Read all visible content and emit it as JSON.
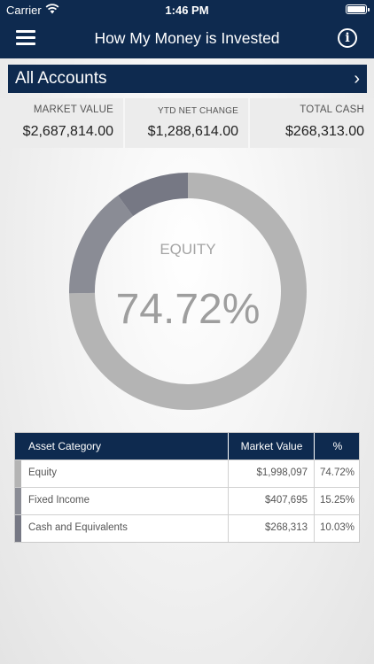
{
  "status_bar": {
    "carrier": "Carrier",
    "time": "1:46 PM"
  },
  "navbar": {
    "title": "How My Money is Invested",
    "info_glyph": "i",
    "menu_icon": "hamburger-menu-icon"
  },
  "accounts": {
    "label": "All Accounts",
    "chevron": "›"
  },
  "summary": [
    {
      "label": "MARKET VALUE",
      "value": "$2,687,814.00"
    },
    {
      "label": "YTD NET CHANGE",
      "value": "$1,288,614.00"
    },
    {
      "label": "TOTAL CASH",
      "value": "$268,313.00"
    }
  ],
  "donut": {
    "label": "EQUITY",
    "value": "74.72%",
    "segments": [
      {
        "name": "Equity",
        "percent": 74.72,
        "color": "#b4b4b4"
      },
      {
        "name": "Fixed Income",
        "percent": 15.25,
        "color": "#8a8c95"
      },
      {
        "name": "Cash and Equivalents",
        "percent": 10.03,
        "color": "#767884"
      }
    ]
  },
  "table": {
    "headers": {
      "category": "Asset Category",
      "market_value": "Market Value",
      "percent": "%"
    },
    "rows": [
      {
        "category": "Equity",
        "market_value": "$1,998,097",
        "percent": "74.72%",
        "color": "#b4b4b4"
      },
      {
        "category": "Fixed Income",
        "market_value": "$407,695",
        "percent": "15.25%",
        "color": "#8a8c95"
      },
      {
        "category": "Cash and Equivalents",
        "market_value": "$268,313",
        "percent": "10.03%",
        "color": "#767884"
      }
    ]
  },
  "colors": {
    "navy": "#0e2a4f"
  }
}
